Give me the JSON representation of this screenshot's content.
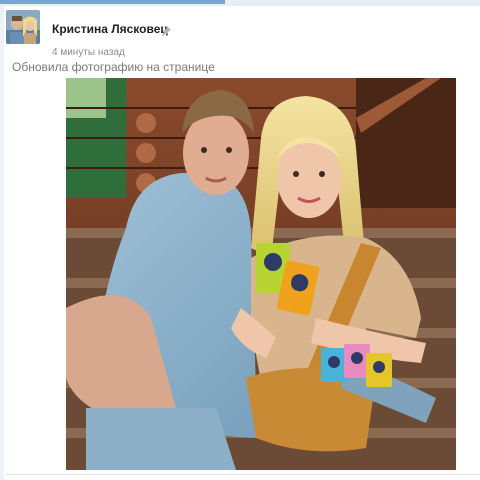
{
  "post": {
    "author_name": "Кристина Лясковец",
    "time": "4 минуты назад",
    "action_text": "Обновила фотографию на странице"
  },
  "icons": {
    "pin": "pin-icon",
    "avatar": "avatar"
  },
  "colors": {
    "accent": "#7aa6d6",
    "author": "#222222",
    "meta": "#8c8c8c"
  }
}
